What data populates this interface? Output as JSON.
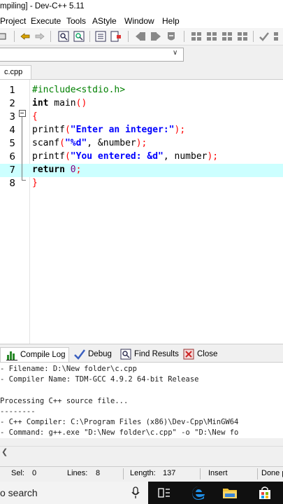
{
  "window": {
    "title": "mpiling] - Dev-C++ 5.11"
  },
  "menu": [
    "Project",
    "Execute",
    "Tools",
    "AStyle",
    "Window",
    "Help"
  ],
  "editor": {
    "tab_label": "c.cpp",
    "lines": [
      {
        "n": "1",
        "parts": [
          {
            "t": "#include<stdio.h>",
            "c": "pp"
          }
        ]
      },
      {
        "n": "2",
        "parts": [
          {
            "t": "int",
            "c": "kw"
          },
          {
            "t": " main",
            "c": ""
          },
          {
            "t": "()",
            "c": "punc"
          }
        ]
      },
      {
        "n": "3",
        "parts": [
          {
            "t": "{",
            "c": "punc"
          }
        ]
      },
      {
        "n": "4",
        "parts": [
          {
            "t": "printf",
            "c": ""
          },
          {
            "t": "(",
            "c": "punc"
          },
          {
            "t": "\"Enter an integer:\"",
            "c": "str"
          },
          {
            "t": ");",
            "c": "punc"
          }
        ]
      },
      {
        "n": "5",
        "parts": [
          {
            "t": "scanf",
            "c": ""
          },
          {
            "t": "(",
            "c": "punc"
          },
          {
            "t": "\"%d\"",
            "c": "str"
          },
          {
            "t": ", &number",
            "c": ""
          },
          {
            "t": ");",
            "c": "punc"
          }
        ]
      },
      {
        "n": "6",
        "parts": [
          {
            "t": "printf",
            "c": ""
          },
          {
            "t": "(",
            "c": "punc"
          },
          {
            "t": "\"You entered: &d\"",
            "c": "str"
          },
          {
            "t": ", number",
            "c": ""
          },
          {
            "t": ");",
            "c": "punc"
          }
        ]
      },
      {
        "n": "7",
        "parts": [
          {
            "t": "return",
            "c": "kw"
          },
          {
            "t": " ",
            "c": ""
          },
          {
            "t": "0",
            "c": "num"
          },
          {
            "t": ";",
            "c": "punc"
          }
        ],
        "highlight": true
      },
      {
        "n": "8",
        "parts": [
          {
            "t": "}",
            "c": "punc"
          }
        ]
      }
    ]
  },
  "bottom_tabs": {
    "compile_log": "Compile Log",
    "debug": "Debug",
    "find_results": "Find Results",
    "close": "Close"
  },
  "log_lines": [
    "- Filename: D:\\New folder\\c.cpp",
    "- Compiler Name: TDM-GCC 4.9.2 64-bit Release",
    "",
    "Processing C++ source file...",
    "--------",
    "- C++ Compiler: C:\\Program Files (x86)\\Dev-Cpp\\MinGW64",
    "- Command: g++.exe \"D:\\New folder\\c.cpp\" -o \"D:\\New fo"
  ],
  "status": {
    "sel_label": "Sel:",
    "sel_value": "0",
    "lines_label": "Lines:",
    "lines_value": "8",
    "length_label": "Length:",
    "length_value": "137",
    "mode": "Insert",
    "state": "Done p"
  },
  "taskbar": {
    "search_text": "o search"
  },
  "colors": {
    "highlight": "#ccffff",
    "string": "#0000ff",
    "preprocessor": "#008000",
    "punctuation": "#ff0000"
  }
}
